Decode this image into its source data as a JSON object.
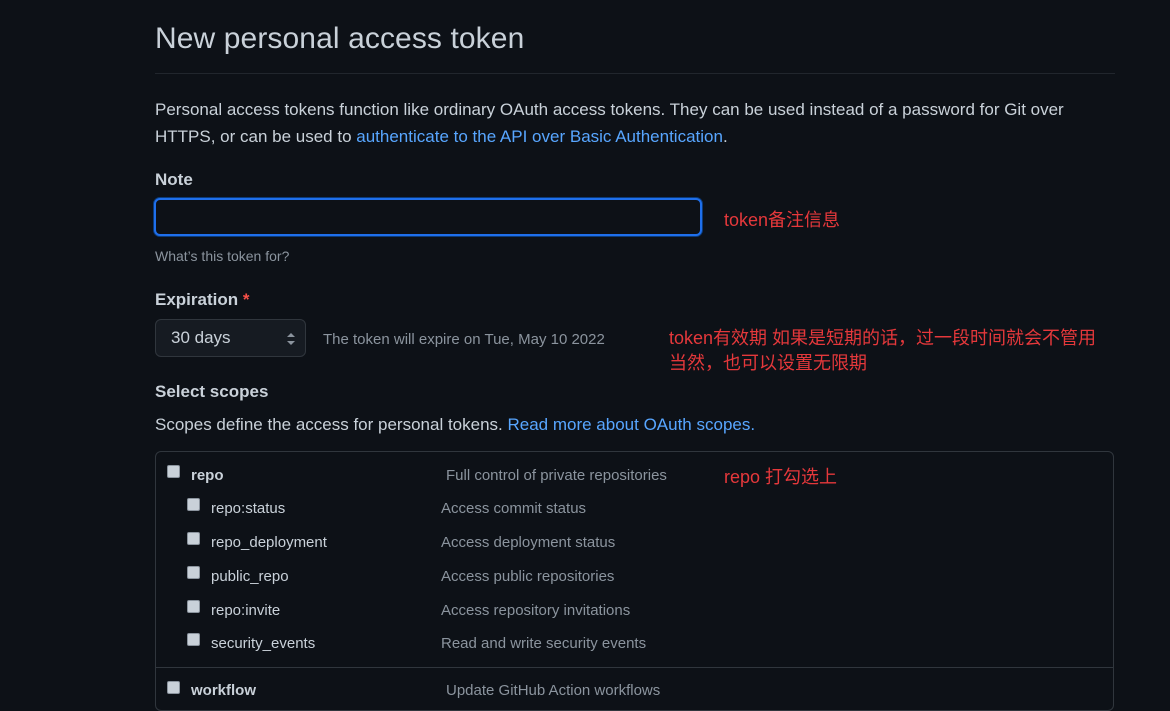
{
  "page": {
    "title": "New personal access token",
    "intro_text": "Personal access tokens function like ordinary OAuth access tokens. They can be used instead of a password for Git over HTTPS, or can be used to ",
    "intro_link": "authenticate to the API over Basic Authentication",
    "intro_end": "."
  },
  "note": {
    "label": "Note",
    "value": "",
    "placeholder": "",
    "hint": "What’s this token for?",
    "annotation": "token备注信息"
  },
  "expiration": {
    "label": "Expiration",
    "required_mark": "*",
    "selected": "30 days",
    "info": "The token will expire on Tue, May 10 2022",
    "annotation_line1": "token有效期 如果是短期的话，过一段时间就会不管用",
    "annotation_line2": "当然，也可以设置无限期"
  },
  "scopes": {
    "heading": "Select scopes",
    "description": "Scopes define the access for personal tokens. ",
    "description_link": "Read more about OAuth scopes.",
    "repo_annotation": "repo 打勾选上",
    "items": [
      {
        "name": "repo",
        "desc": "Full control of private repositories",
        "checked": false
      },
      {
        "name": "repo:status",
        "desc": "Access commit status",
        "checked": false
      },
      {
        "name": "repo_deployment",
        "desc": "Access deployment status",
        "checked": false
      },
      {
        "name": "public_repo",
        "desc": "Access public repositories",
        "checked": false
      },
      {
        "name": "repo:invite",
        "desc": "Access repository invitations",
        "checked": false
      },
      {
        "name": "security_events",
        "desc": "Read and write security events",
        "checked": false
      },
      {
        "name": "workflow",
        "desc": "Update GitHub Action workflows",
        "checked": false
      }
    ]
  },
  "colors": {
    "background": "#0d1117",
    "link": "#58a6ff",
    "annotation": "#e5383b",
    "focus_border": "#1f6feb"
  }
}
